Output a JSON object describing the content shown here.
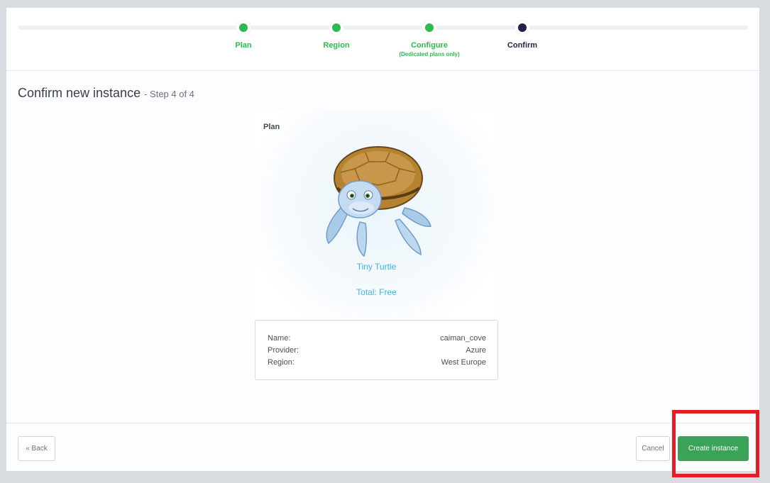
{
  "steps": [
    {
      "label": "Plan",
      "sub": "",
      "state": "done"
    },
    {
      "label": "Region",
      "sub": "",
      "state": "done"
    },
    {
      "label": "Configure",
      "sub": "(Dedicated plans only)",
      "state": "done"
    },
    {
      "label": "Confirm",
      "sub": "",
      "state": "current"
    }
  ],
  "header": {
    "title": "Confirm new instance",
    "step_info": "- Step 4 of 4"
  },
  "plan": {
    "section_label": "Plan",
    "name": "Tiny Turtle",
    "total": "Total: Free",
    "icon": "turtle-mascot"
  },
  "details": {
    "rows": [
      {
        "key": "Name:",
        "value": "caiman_cove"
      },
      {
        "key": "Provider:",
        "value": "Azure"
      },
      {
        "key": "Region:",
        "value": "West Europe"
      }
    ]
  },
  "footer": {
    "back_label": "« Back",
    "cancel_label": "Cancel",
    "create_label": "Create instance"
  },
  "colors": {
    "done": "#2dbb4e",
    "current": "#1f2243",
    "accent": "#3fb3e0",
    "create_button": "#3aa357",
    "highlight": "#e41c24"
  }
}
